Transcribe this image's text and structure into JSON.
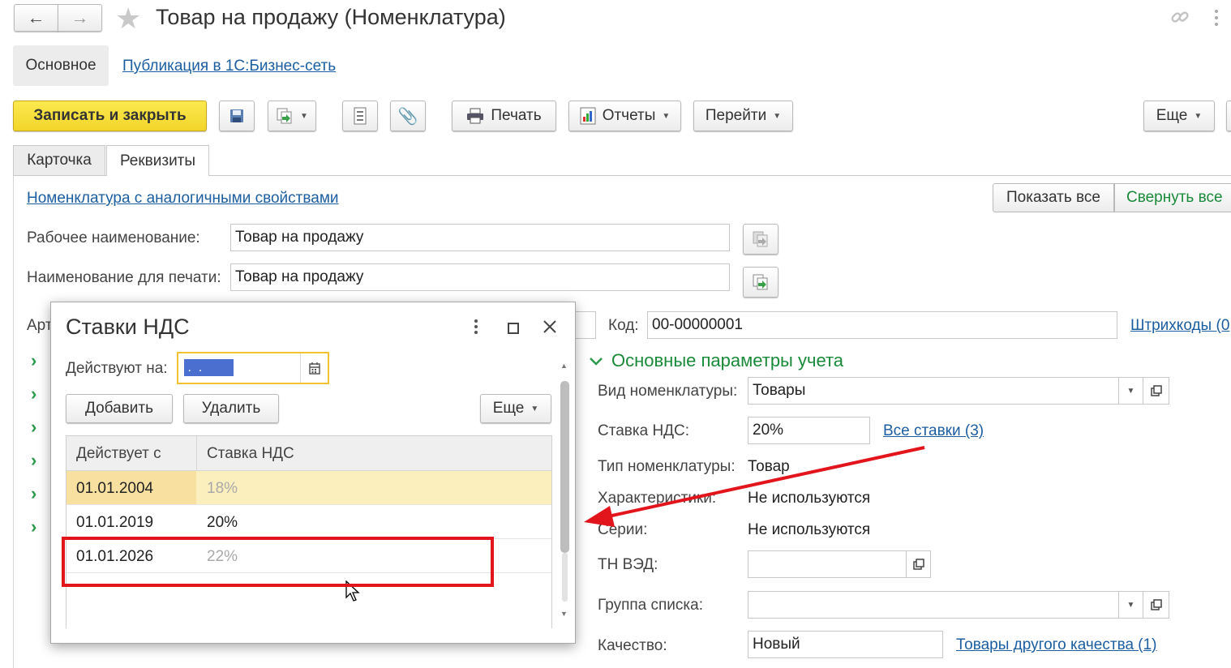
{
  "window": {
    "title": "Товар на продажу (Номенклатура)",
    "nav_back": "←",
    "nav_forward": "→"
  },
  "tabs_top": {
    "main": "Основное",
    "publish": "Публикация в 1С:Бизнес-сеть"
  },
  "toolbar": {
    "save_close": "Записать и закрыть",
    "print": "Печать",
    "reports": "Отчеты",
    "goto": "Перейти",
    "more": "Еще"
  },
  "subtabs": {
    "card": "Карточка",
    "requisites": "Реквизиты"
  },
  "form": {
    "similar_link": "Номенклатура с аналогичными свойствами",
    "show_all": "Показать все",
    "collapse_all": "Свернуть все",
    "work_name_label": "Рабочее наименование:",
    "work_name_value": "Товар на продажу",
    "print_name_label": "Наименование для печати:",
    "print_name_value": "Товар на продажу",
    "article_label": "Арт",
    "code_label": "Код:",
    "code_value": "00-00000001",
    "barcodes_link": "Штрихкоды (0",
    "section_title": "Основные параметры учета",
    "kind_label": "Вид номенклатуры:",
    "kind_value": "Товары",
    "vat_label": "Ставка НДС:",
    "vat_value": "20%",
    "all_rates_link": "Все ставки (3)",
    "type_label": "Тип номенклатуры:",
    "type_value": "Товар",
    "chars_label": "Характеристики:",
    "chars_value": "Не используются",
    "series_label": "Серии:",
    "series_value": "Не используются",
    "tnved_label": "ТН ВЭД:",
    "tnved_value": "",
    "group_label": "Группа списка:",
    "group_value": "",
    "quality_label": "Качество:",
    "quality_value": "Новый",
    "other_quality_link": "Товары другого качества (1)"
  },
  "dialog": {
    "title": "Ставки НДС",
    "effective_label": "Действуют на:",
    "date_value": " .  .",
    "add": "Добавить",
    "delete": "Удалить",
    "more": "Еще",
    "col_from": "Действует с",
    "col_rate": "Ставка НДС",
    "rows": [
      {
        "date": "01.01.2004",
        "rate": "18%"
      },
      {
        "date": "01.01.2019",
        "rate": "20%"
      },
      {
        "date": "01.01.2026",
        "rate": "22%"
      }
    ]
  },
  "colors": {
    "accent_yellow": "#f7e03c",
    "link_blue": "#1c5ea0",
    "section_green": "#1a8a3a",
    "selected_row": "#fcefbe",
    "annotation_red": "#e3151c"
  }
}
